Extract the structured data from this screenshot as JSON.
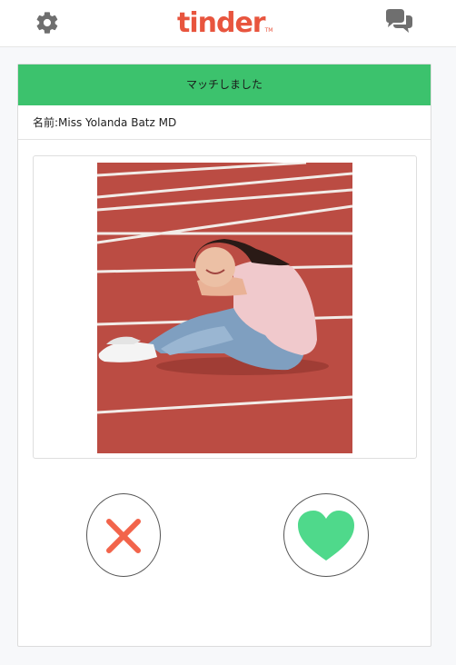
{
  "header": {
    "logo_text": "tinder",
    "logo_tm": "TM",
    "settings_icon": "gear-icon",
    "messages_icon": "chat-bubbles-icon"
  },
  "card": {
    "status_banner": "マッチしました",
    "name_line": "名前:Miss Yolanda Batz MD",
    "photo_description_icon": "profile-photo"
  },
  "actions": {
    "nope_icon": "x-icon",
    "like_icon": "heart-icon"
  },
  "colors": {
    "brand": "#e8553e",
    "banner": "#3cc26d",
    "nope": "#f2644b",
    "like": "#4fd98b",
    "icon_gray": "#777777"
  }
}
